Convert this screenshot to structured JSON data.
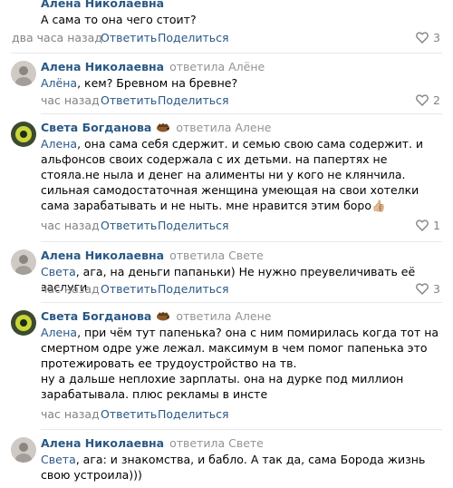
{
  "actions": {
    "reply": "Ответить",
    "share": "Поделиться"
  },
  "comments": [
    {
      "author": "Алена Николаевна",
      "replied_to": "",
      "mention": "",
      "text": "А сама то она чего стоит?",
      "time": "два часа назад",
      "likes": "3"
    },
    {
      "author": "Алена Николаевна",
      "replied_to": "ответила Алёне",
      "mention": "Алёна",
      "text": ", кем? Бревном на бревне?",
      "time": "час назад",
      "likes": "2"
    },
    {
      "author": "Света Богданова",
      "replied_to": "ответила Алене",
      "mention": "Алена",
      "text": ", она сама себя сдержит. и семью свою сама содержит. и альфонсов своих содержала с их детьми. на папертях не стояла.не ныла и денег на алименты ни у кого не клянчила. сильная самодостаточная женщина умеющая на свои хотелки сама зарабатывать и не ныть. мне нравится этим боро👍🏼",
      "time": "час назад",
      "likes": "1"
    },
    {
      "author": "Алена Николаевна",
      "replied_to": "ответила Свете",
      "mention": "Света",
      "text": ", ага, на деньги папаньки) Не нужно преувеличивать её заслуги",
      "time": "час назад",
      "likes": "3"
    },
    {
      "author": "Света Богданова",
      "replied_to": "ответила Алене",
      "mention": "Алена",
      "text": ", при чём тут папенька? она с ним помирилась когда тот на смертном одре уже лежал. максимум в чем помог папенька это протежировать ее трудоустройство на тв.",
      "text2": "ну а дальше неплохие зарплаты. она на дурке под миллион зарабатывала. плюс рекламы в инсте",
      "time": "час назад",
      "likes": ""
    },
    {
      "author": "Алена Николаевна",
      "replied_to": "ответила Свете",
      "mention": "Света",
      "text": ", ага: и знакомства, и бабло. А так да, сама Борода жизнь свою устроила)))",
      "time": "",
      "likes": ""
    }
  ]
}
